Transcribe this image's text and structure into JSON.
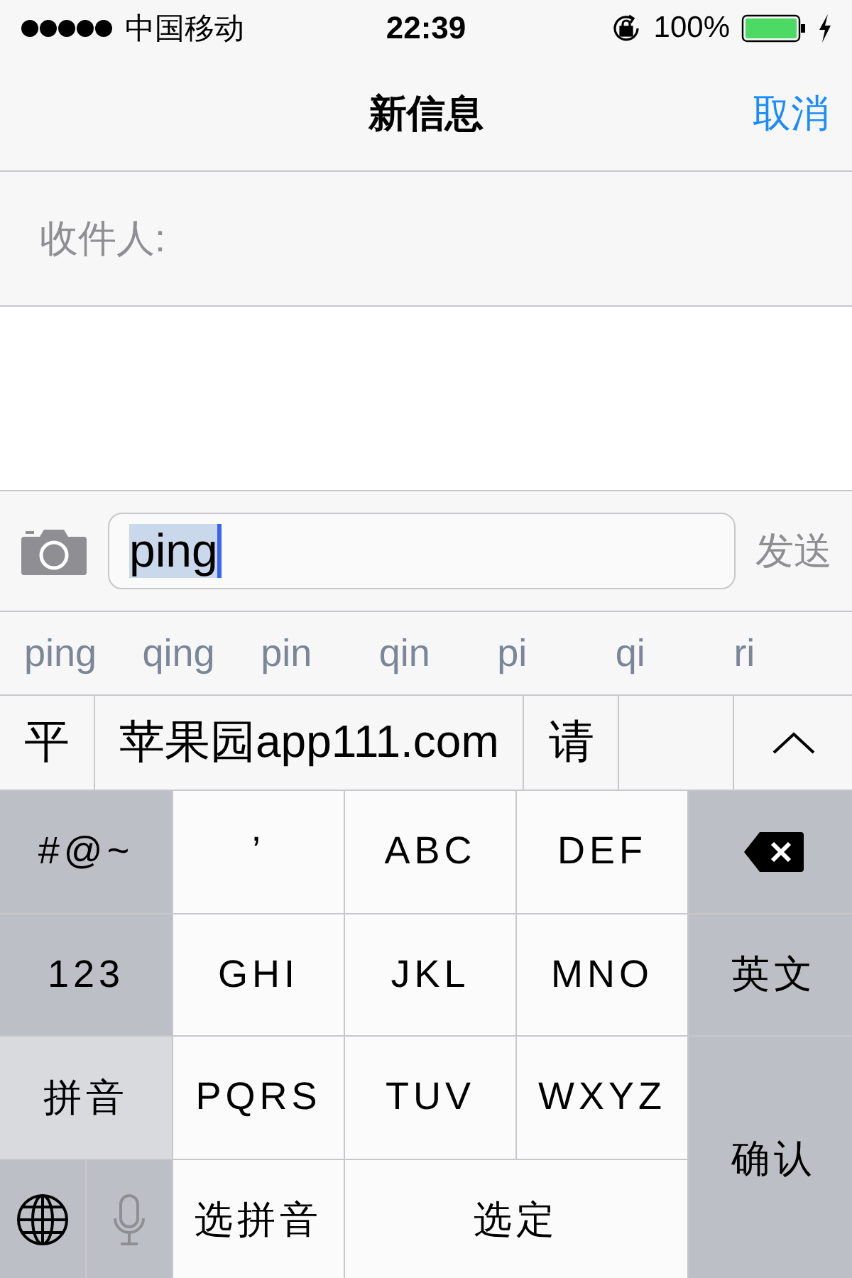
{
  "status_bar": {
    "carrier": "中国移动",
    "time": "22:39",
    "battery": "100%"
  },
  "nav": {
    "title": "新信息",
    "cancel": "取消"
  },
  "recipient": {
    "label": "收件人:"
  },
  "compose": {
    "value": "ping",
    "send": {
      "label": "发送",
      "disabled": true
    }
  },
  "pinyin_options": [
    "ping",
    "qing",
    "pin",
    "qin",
    "pi",
    "qi",
    "ri"
  ],
  "candidates": [
    "平",
    "苹果园app111.com",
    "请"
  ],
  "keyboard": [
    {
      "label": "#@~",
      "kind": "function"
    },
    {
      "label": "’",
      "kind": "letter"
    },
    {
      "label": "ABC",
      "kind": "letter"
    },
    {
      "label": "DEF",
      "kind": "letter"
    },
    {
      "kind": "delete"
    },
    {
      "label": "123",
      "kind": "function"
    },
    {
      "label": "GHI",
      "kind": "letter"
    },
    {
      "label": "JKL",
      "kind": "letter"
    },
    {
      "label": "MNO",
      "kind": "letter"
    },
    {
      "label": "英文",
      "kind": "function"
    },
    {
      "label": "拼音",
      "kind": "mode"
    },
    {
      "label": "PQRS",
      "kind": "letter"
    },
    {
      "label": "TUV",
      "kind": "letter"
    },
    {
      "label": "WXYZ",
      "kind": "letter"
    },
    {
      "label": "确认",
      "kind": "function"
    },
    {
      "kind": "globe"
    },
    {
      "kind": "mic"
    },
    {
      "label": "选拼音",
      "kind": "letter"
    },
    {
      "label": "选定",
      "kind": "letter"
    }
  ]
}
